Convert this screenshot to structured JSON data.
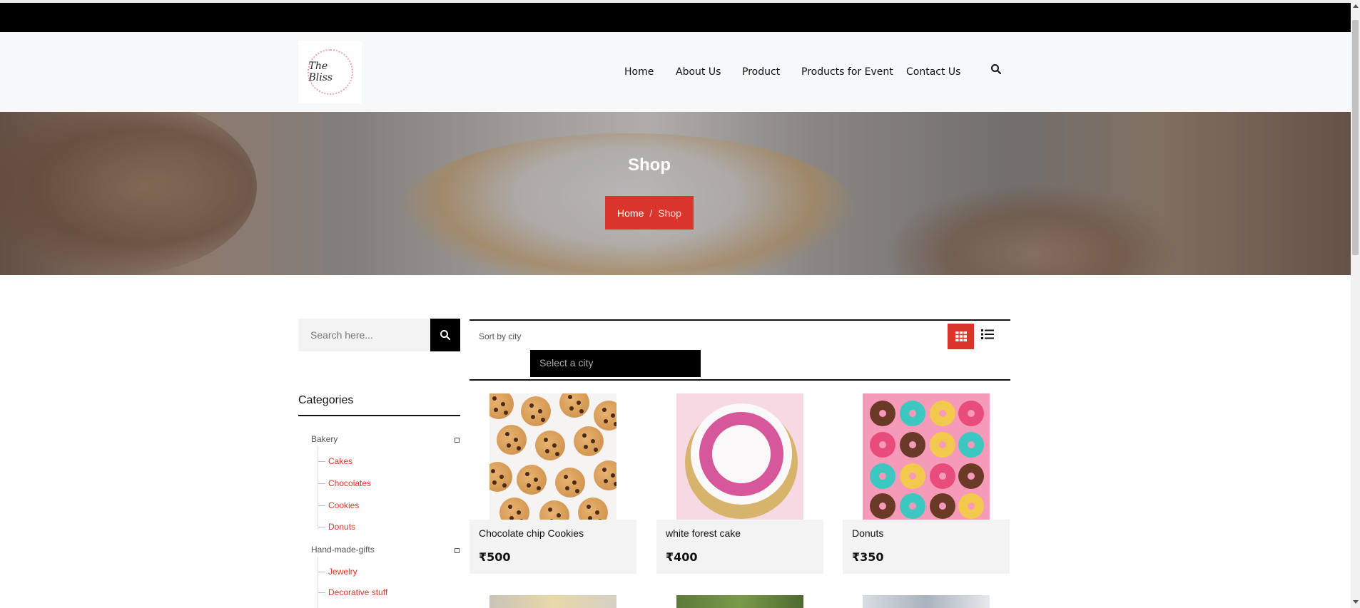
{
  "brand": {
    "logo_text": "The Bliss"
  },
  "nav": {
    "items": [
      {
        "label": "Home"
      },
      {
        "label": "About Us"
      },
      {
        "label": "Product"
      },
      {
        "label": "Products for Event"
      },
      {
        "label": "Contact Us"
      }
    ],
    "search_icon": "search-icon"
  },
  "hero": {
    "title": "Shop",
    "breadcrumb": {
      "home": "Home",
      "separator": "/",
      "current": "Shop"
    }
  },
  "sidebar": {
    "search_placeholder": "Search here...",
    "categories_title": "Categories",
    "categories": [
      {
        "label": "Bakery",
        "children": [
          "Cakes",
          "Chocolates",
          "Cookies",
          "Donuts"
        ]
      },
      {
        "label": "Hand-made-gifts",
        "children": [
          "Jewelry",
          "Decorative stuff"
        ]
      }
    ]
  },
  "toolbar": {
    "sort_label": "Sort by city",
    "city_select": "Select a city",
    "grid_view_icon": "grid-view-icon",
    "list_view_icon": "list-view-icon"
  },
  "products": [
    {
      "name": "Chocolate chip Cookies",
      "price": "₹500"
    },
    {
      "name": "white forest cake",
      "price": "₹400"
    },
    {
      "name": "Donuts",
      "price": "₹350"
    }
  ],
  "colors": {
    "accent": "#d9352a",
    "topbar": "#000000",
    "header_bg": "#f7f8fa"
  }
}
